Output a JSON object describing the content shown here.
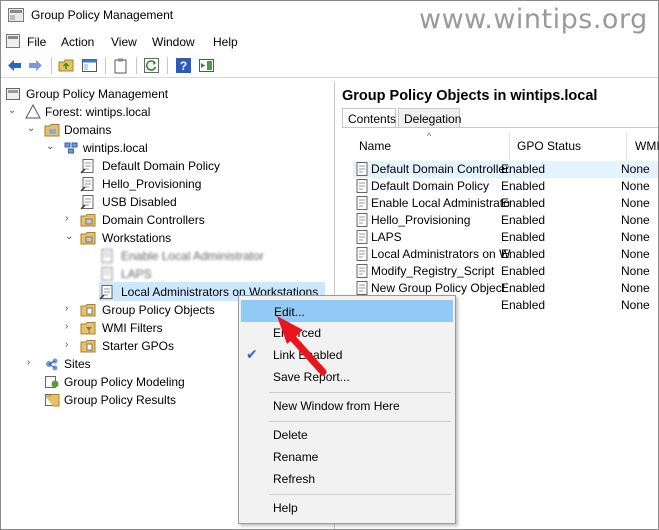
{
  "window": {
    "title": "Group Policy Management"
  },
  "watermark": "www.wintips.org",
  "menubar": {
    "items": [
      "File",
      "Action",
      "View",
      "Window",
      "Help"
    ]
  },
  "tree": {
    "root": "Group Policy Management",
    "forest": "Forest: wintips.local",
    "domains": "Domains",
    "domain": "wintips.local",
    "default_policy": "Default Domain Policy",
    "hello_provisioning": "Hello_Provisioning",
    "usb_disabled": "USB Disabled",
    "domain_controllers": "Domain Controllers",
    "workstations": "Workstations",
    "enable_local_admin": "Enable Local Administrator",
    "laps": "LAPS",
    "local_admins_on_ws": "Local Administrators on Workstations",
    "gpo": "Group Policy Objects",
    "wmi_filters": "WMI Filters",
    "starter_gpos": "Starter GPOs",
    "sites": "Sites",
    "modeling": "Group Policy Modeling",
    "results": "Group Policy Results"
  },
  "right_pane": {
    "title": "Group Policy Objects in wintips.local",
    "tabs": [
      "Contents",
      "Delegation"
    ],
    "columns": [
      "Name",
      "GPO Status",
      "WMI"
    ],
    "rows": [
      {
        "name": "Default Domain Controller...",
        "status": "Enabled",
        "wmi": "None"
      },
      {
        "name": "Default Domain Policy",
        "status": "Enabled",
        "wmi": "None"
      },
      {
        "name": "Enable Local Administrator",
        "status": "Enabled",
        "wmi": "None"
      },
      {
        "name": "Hello_Provisioning",
        "status": "Enabled",
        "wmi": "None"
      },
      {
        "name": "LAPS",
        "status": "Enabled",
        "wmi": "None"
      },
      {
        "name": "Local Administrators on W...",
        "status": "Enabled",
        "wmi": "None"
      },
      {
        "name": "Modify_Registry_Script",
        "status": "Enabled",
        "wmi": "None"
      },
      {
        "name": "New Group Policy Object",
        "status": "Enabled",
        "wmi": "None"
      },
      {
        "name": "",
        "status": "Enabled",
        "wmi": "None"
      }
    ]
  },
  "context_menu": {
    "edit": "Edit...",
    "enforced": "Enforced",
    "link_enabled": "Link Enabled",
    "save_report": "Save Report...",
    "new_window": "New Window from Here",
    "delete": "Delete",
    "rename": "Rename",
    "refresh": "Refresh",
    "help": "Help"
  },
  "colors": {
    "selection": "#cce8ff",
    "menu_hover": "#91c9f7",
    "arrow": "#e8141e",
    "check": "#2b6cd6"
  }
}
